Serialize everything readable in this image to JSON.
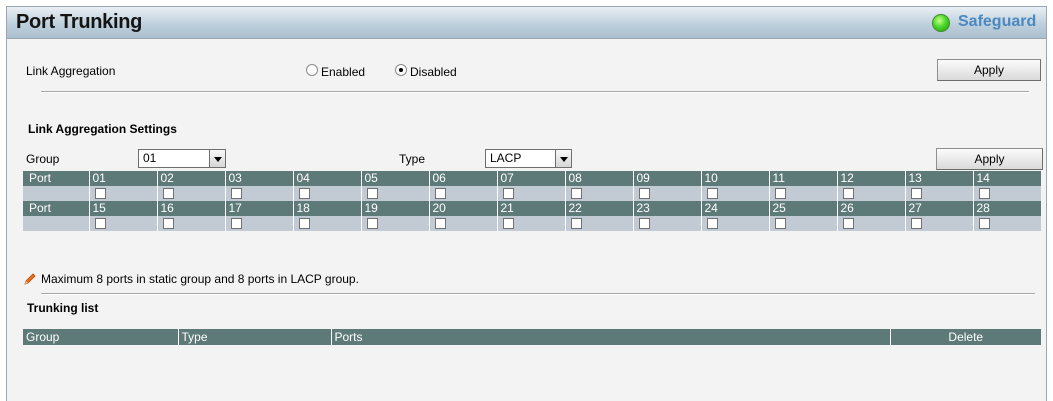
{
  "header": {
    "title": "Port Trunking",
    "safeguard_label": "Safeguard"
  },
  "link_aggregation": {
    "label": "Link Aggregation",
    "enabled_label": "Enabled",
    "disabled_label": "Disabled",
    "selected": "Disabled",
    "apply_label": "Apply"
  },
  "settings": {
    "heading": "Link Aggregation Settings",
    "group_label": "Group",
    "group_value": "01",
    "type_label": "Type",
    "type_value": "LACP",
    "apply_label": "Apply"
  },
  "ports_table": {
    "row_header": "Port",
    "row1": [
      "01",
      "02",
      "03",
      "04",
      "05",
      "06",
      "07",
      "08",
      "09",
      "10",
      "11",
      "12",
      "13",
      "14"
    ],
    "row2": [
      "15",
      "16",
      "17",
      "18",
      "19",
      "20",
      "21",
      "22",
      "23",
      "24",
      "25",
      "26",
      "27",
      "28"
    ]
  },
  "note": "Maximum 8 ports in static group and 8 ports in LACP group.",
  "trunking_list": {
    "heading": "Trunking list",
    "columns": [
      "Group",
      "Type",
      "Ports",
      "Delete"
    ]
  },
  "colors": {
    "table_header": "#5e7a78",
    "table_cell": "#c2cbd3",
    "safeguard_text": "#4b88bf",
    "safeguard_led": "#4cd82c"
  }
}
